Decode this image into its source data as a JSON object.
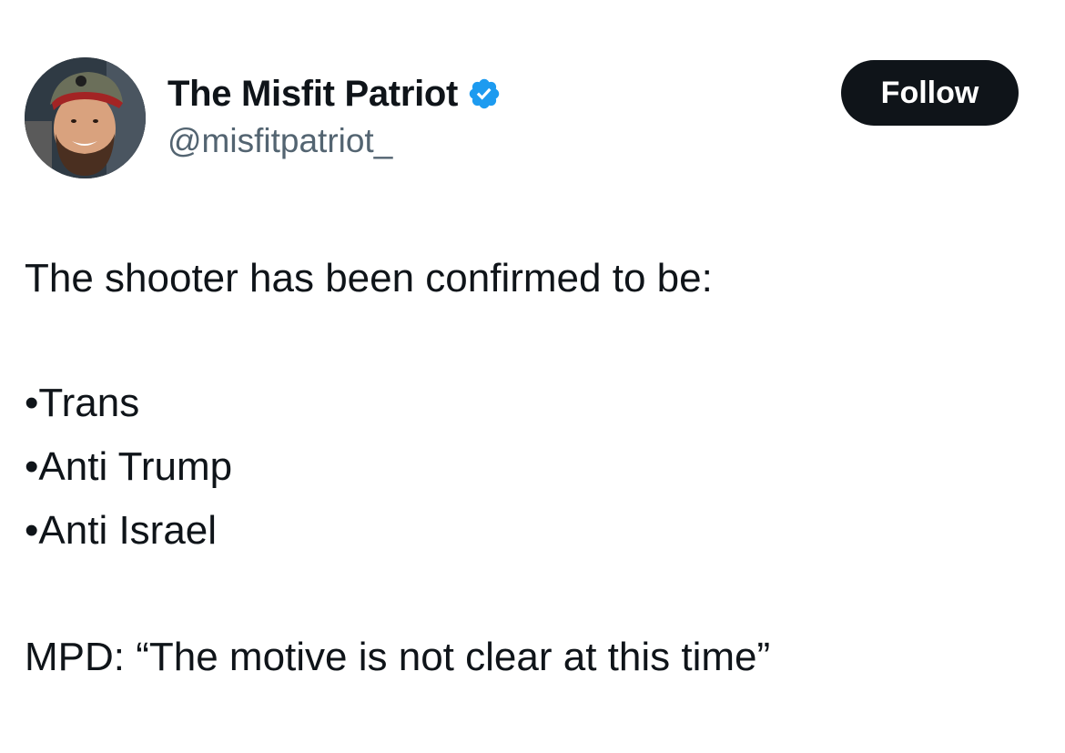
{
  "author": {
    "display_name": "The Misfit Patriot",
    "handle": "@misfitpatriot_",
    "verified": true,
    "badge_color": "#1d9bf0",
    "avatar_icon": "profile-photo"
  },
  "follow_button": {
    "label": "Follow",
    "background": "#0f1419",
    "text_color": "#ffffff"
  },
  "tweet": {
    "intro": "The shooter has been confirmed to be:",
    "bullets": [
      "•Trans",
      "•Anti Trump",
      "•Anti Israel"
    ],
    "closing": "MPD: “The motive is not clear at this time”"
  }
}
